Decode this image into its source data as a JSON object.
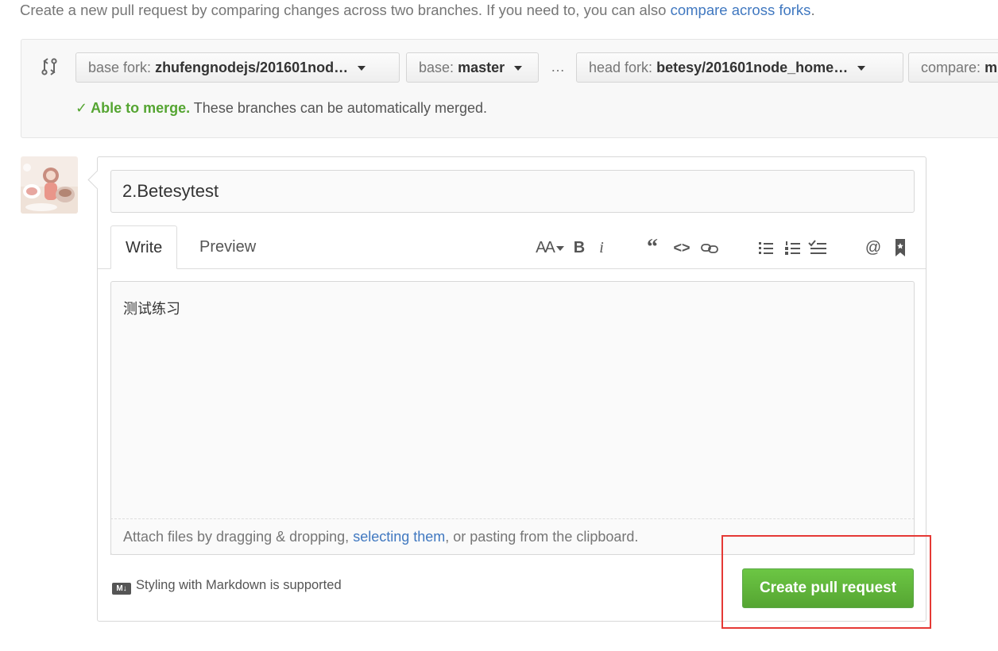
{
  "intro": {
    "text": "Create a new pull request by comparing changes across two branches. If you need to, you can also ",
    "link": "compare across forks",
    "end": "."
  },
  "range": {
    "base_fork_label": "base fork:",
    "base_fork_value": "zhufengnodejs/201601nod…",
    "base_label": "base:",
    "base_value": "master",
    "dots": "…",
    "head_fork_label": "head fork:",
    "head_fork_value": "betesy/201601node_home…",
    "compare_label": "compare:",
    "compare_value": "m"
  },
  "merge": {
    "check": "✓",
    "status": "Able to merge.",
    "message": " These branches can be automatically merged."
  },
  "form": {
    "title_value": "2.Betesytest",
    "tabs": [
      "Write",
      "Preview"
    ],
    "body_value": "测试练习",
    "drag_prefix": "Attach files by dragging & dropping, ",
    "drag_link": "selecting them",
    "drag_suffix": ", or pasting from the clipboard.",
    "markdown_badge": "M↓",
    "markdown_note": "Styling with Markdown is supported",
    "submit_label": "Create pull request"
  },
  "toolbar": {
    "heading": "AA",
    "bold": "B",
    "italic": "i",
    "quote": "“",
    "code": "<>",
    "mention": "@"
  },
  "colors": {
    "accent_link": "#4078c0",
    "success": "#55a532",
    "highlight_box": "#e53935"
  }
}
